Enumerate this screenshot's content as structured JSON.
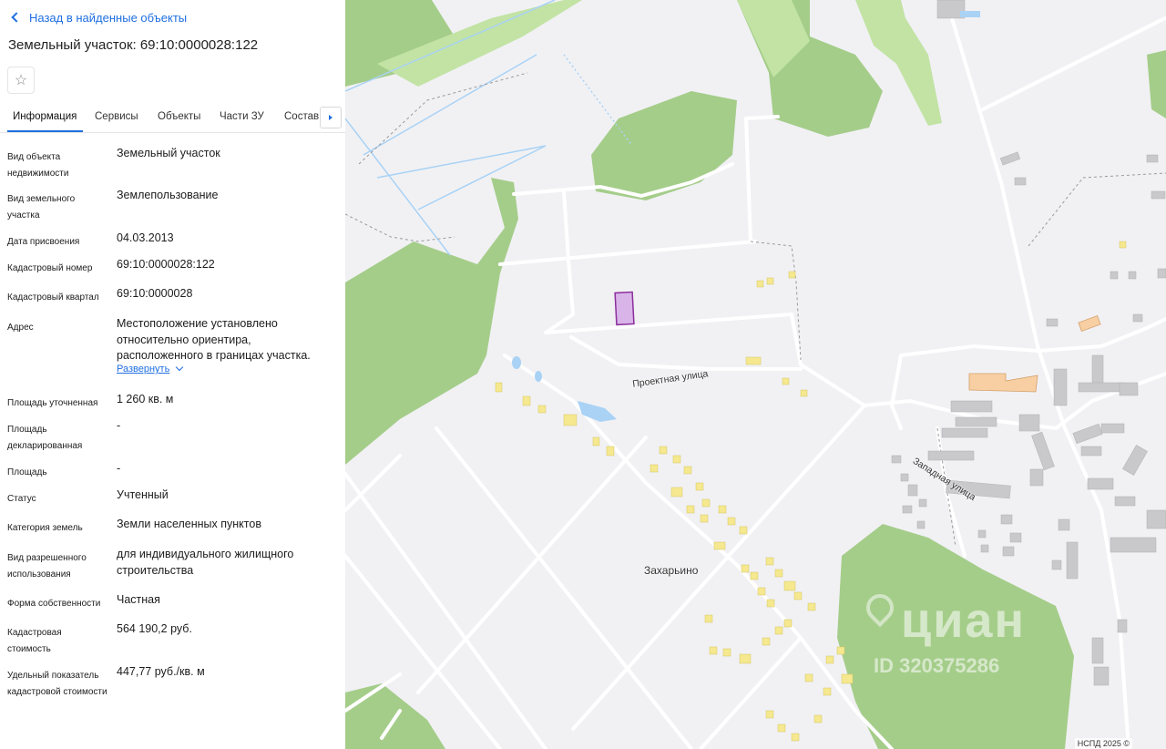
{
  "nav": {
    "back_label": "Назад в найденные объекты"
  },
  "title": "Земельный участок: 69:10:0000028:122",
  "tabs": [
    "Информация",
    "Сервисы",
    "Объекты",
    "Части ЗУ",
    "Состав"
  ],
  "active_tab": "Информация",
  "icons": {
    "back": "chevron-left-icon",
    "favorite": "star-icon",
    "tabs_next": "chevron-right-icon",
    "expand": "chevron-down-icon"
  },
  "colors": {
    "accent": "#1f6fe0",
    "parcel_fill": "#d9b4e8",
    "parcel_stroke": "#8b2f9c",
    "forest": "#a5cd8a"
  },
  "details": [
    {
      "label": "Вид объекта недвижимости",
      "value": "Земельный участок"
    },
    {
      "label": "Вид земельного участка",
      "value": "Землепользование"
    },
    {
      "label": "Дата присвоения",
      "value": "04.03.2013"
    },
    {
      "label": "Кадастровый номер",
      "value": "69:10:0000028:122"
    },
    {
      "label": "Кадастровый квартал",
      "value": "69:10:0000028"
    },
    {
      "label": "Адрес",
      "value": "Местоположение установлено относительно ориентира, расположенного в границах участка.",
      "expand_label": "Развернуть"
    },
    {
      "label": "Площадь уточненная",
      "value": "1 260 кв. м"
    },
    {
      "label": "Площадь декларированная",
      "value": "-"
    },
    {
      "label": "Площадь",
      "value": "-"
    },
    {
      "label": "Статус",
      "value": "Учтенный"
    },
    {
      "label": "Категория земель",
      "value": "Земли населенных пунктов"
    },
    {
      "label": "Вид разрешенного использования",
      "value": "для индивидуального жилищного строительства"
    },
    {
      "label": "Форма собственности",
      "value": "Частная"
    },
    {
      "label": "Кадастровая стоимость",
      "value": "564 190,2 руб."
    },
    {
      "label": "Удельный показатель кадастровой стоимости",
      "value": "447,77 руб./кв. м"
    }
  ],
  "map": {
    "labels": {
      "street1": "Проектная улица",
      "street2": "Западная улица",
      "village": "Захарьино"
    },
    "watermark": "циан",
    "watermark_id": "ID 320375286",
    "attribution": "НСПД 2025 ©"
  }
}
